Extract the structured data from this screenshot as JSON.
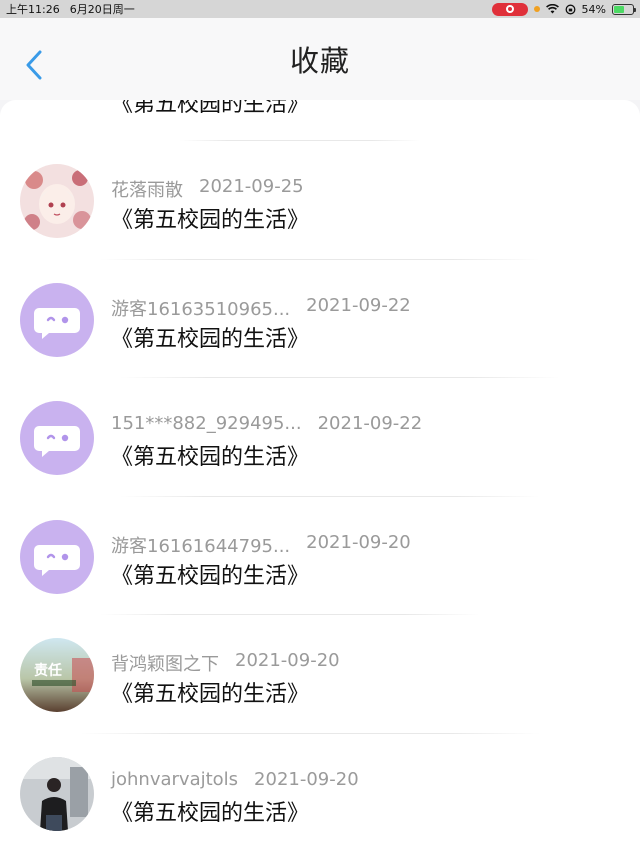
{
  "status_bar": {
    "time": "上午11:26",
    "date": "6月20日周一",
    "battery": "54%",
    "battery_level": 0.54
  },
  "header": {
    "title": "收藏"
  },
  "colors": {
    "accent": "#3a9be8",
    "guest_avatar_bg": "#c9b2ef"
  },
  "partial_item": {
    "title": "《第五校园的生活》"
  },
  "items": [
    {
      "username": "花落雨散",
      "date": "2021-09-25",
      "title": "《第五校园的生活》",
      "avatar": "anime-girl-avatar"
    },
    {
      "username": "游客16163510965...",
      "date": "2021-09-22",
      "title": "《第五校园的生活》",
      "avatar": "guest-chat-avatar"
    },
    {
      "username": "151***882_929495...",
      "date": "2021-09-22",
      "title": "《第五校园的生活》",
      "avatar": "guest-chat-avatar"
    },
    {
      "username": "游客16161644795...",
      "date": "2021-09-20",
      "title": "《第五校园的生活》",
      "avatar": "guest-chat-avatar"
    },
    {
      "username": "背鸿颖图之下",
      "date": "2021-09-20",
      "title": "《第五校园的生活》",
      "avatar": "responsibility-avatar",
      "avatar_text": "责任"
    },
    {
      "username": "johnvarvajtols",
      "date": "2021-09-20",
      "title": "《第五校园的生活》",
      "avatar": "man-photo-avatar"
    }
  ]
}
